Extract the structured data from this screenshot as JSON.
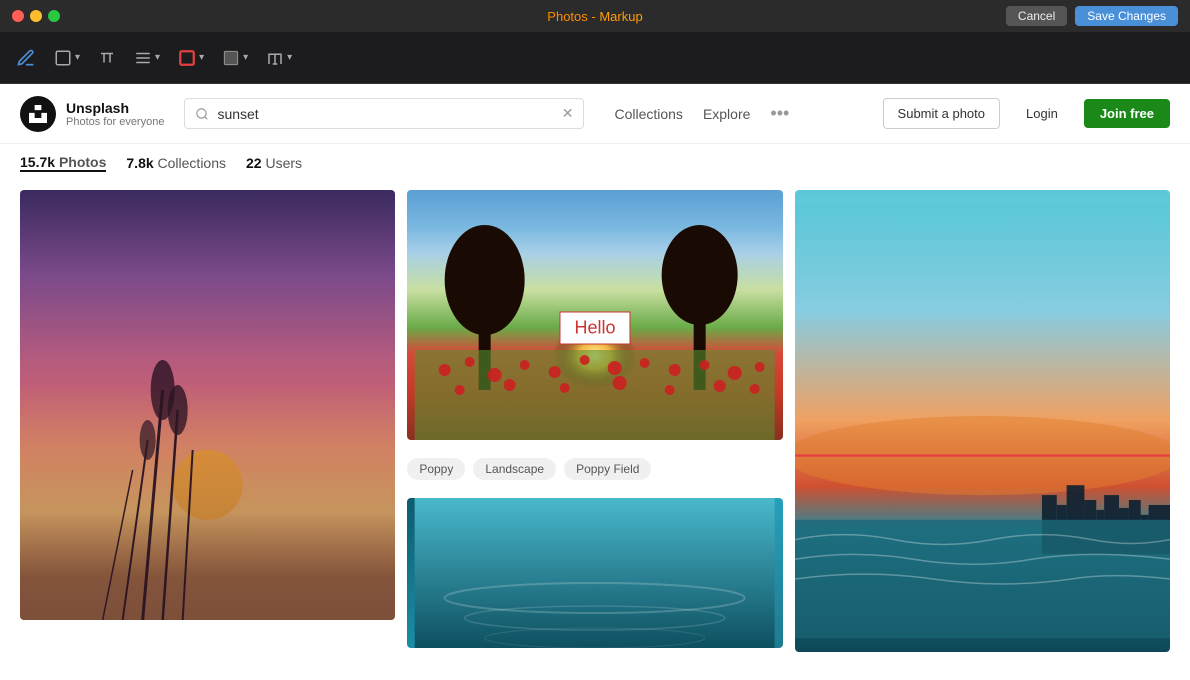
{
  "titleBar": {
    "title": "Photos",
    "subtitle": "Markup",
    "cancelLabel": "Cancel",
    "saveLabel": "Save Changes"
  },
  "toolbar": {
    "penIcon": "✏",
    "shapeIcon": "shape",
    "textIcon": "T",
    "linesIcon": "≡",
    "borderIcon": "border",
    "fillIcon": "fill",
    "fontIcon": "A"
  },
  "nav": {
    "logoTitle": "Unsplash",
    "logoSubtitle": "Photos for everyone",
    "searchPlaceholder": "sunset",
    "searchValue": "sunset",
    "collectionsLabel": "Collections",
    "exploreLabel": "Explore",
    "submitLabel": "Submit a photo",
    "loginLabel": "Login",
    "joinLabel": "Join free"
  },
  "resultsBar": {
    "photosCount": "15.7k",
    "photosLabel": "Photos",
    "collectionsCount": "7.8k",
    "collectionsLabel": "Collections",
    "usersCount": "22",
    "usersLabel": "Users"
  },
  "photos": {
    "helloText": "Hello",
    "tags": [
      "Poppy",
      "Landscape",
      "Poppy Field"
    ]
  },
  "colors": {
    "accent": "#4a90d9",
    "joinBtnBg": "#1a8917",
    "helloColor": "#cc3333",
    "redLineColor": "#e84040"
  }
}
